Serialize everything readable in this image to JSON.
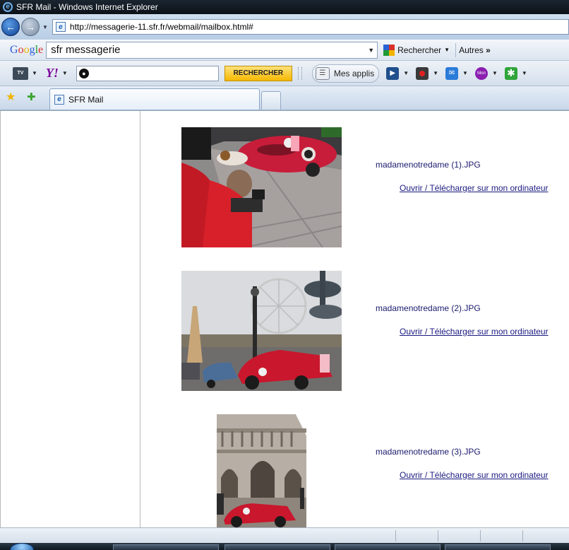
{
  "window": {
    "title": "SFR Mail - Windows Internet Explorer"
  },
  "address_bar": {
    "url": "http://messagerie-11.sfr.fr/webmail/mailbox.html#"
  },
  "google_toolbar": {
    "logo_text": "Google",
    "search_value": "sfr messagerie",
    "search_button": "Rechercher",
    "more_label": "Autres"
  },
  "yahoo_toolbar": {
    "tv_label": "TV",
    "logo_text": "Y!",
    "search_value": "",
    "search_button": "RECHERCHER",
    "apps_label": "Mes applis",
    "mon_label": "Mon"
  },
  "tabs": [
    {
      "label": "SFR Mail"
    }
  ],
  "attachments": [
    {
      "filename": "madamenotredame (1).JPG",
      "link_label": "Ouvrir / Télécharger sur mon ordinateur"
    },
    {
      "filename": "madamenotredame (2).JPG",
      "link_label": "Ouvrir / Télécharger sur mon ordinateur"
    },
    {
      "filename": "madamenotredame (3).JPG",
      "link_label": "Ouvrir / Télécharger sur mon ordinateur"
    }
  ],
  "icons": {
    "back": "back-arrow-icon",
    "forward": "forward-arrow-icon",
    "favorites": "star-icon",
    "add_favorite": "add-favorite-icon"
  },
  "colors": {
    "link": "#1a1a80",
    "filename": "#1a1a6e",
    "yahoo": "#7b0099",
    "yahoo_button": "#f5b800"
  }
}
